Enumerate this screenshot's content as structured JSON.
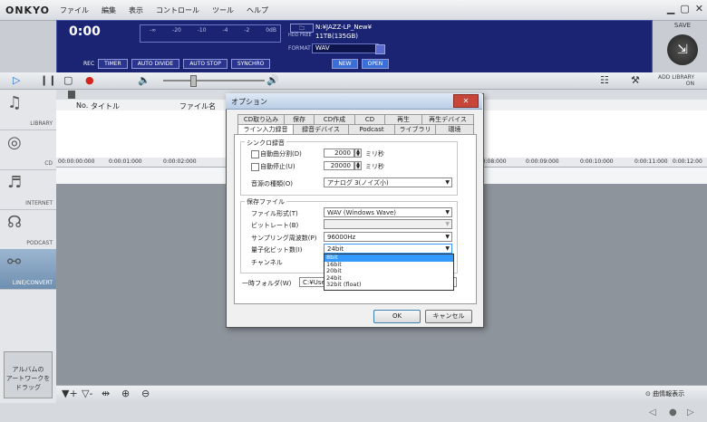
{
  "app": {
    "logo": "ONKYO",
    "menu": [
      "ファイル",
      "編集",
      "表示",
      "コントロール",
      "ツール",
      "ヘルプ"
    ]
  },
  "panel": {
    "time": "0:00",
    "meter_scale": [
      "-∞",
      "-20",
      "-10",
      "-4",
      "-2",
      "0dB"
    ],
    "directory": "N:¥JAZZ-LP_New¥",
    "hdd_free": "11TB(135GB)",
    "format_label": "FORMAT",
    "format_value": "WAV",
    "rec_label": "REC",
    "rec_buttons": [
      "TIMER",
      "AUTO DIVIDE",
      "AUTO STOP",
      "SYNCHRO"
    ],
    "new_label": "NEW",
    "open_label": "OPEN",
    "save_label": "SAVE"
  },
  "toolbar": {
    "add_library": "ADD LIBRARY",
    "add_library_state": "ON"
  },
  "sidebar": {
    "items": [
      {
        "label": "LIBRARY",
        "icon": "library-icon"
      },
      {
        "label": "CD",
        "icon": "cd-icon"
      },
      {
        "label": "INTERNET",
        "icon": "internet-icon"
      },
      {
        "label": "PODCAST",
        "icon": "podcast-icon"
      },
      {
        "label": "LINE/CONVERT",
        "icon": "line-convert-icon"
      }
    ],
    "album_art": "アルバムの\nアートワークを\nドラッグ"
  },
  "list": {
    "columns": [
      "No.",
      "タイトル",
      "ファイル名"
    ]
  },
  "timeline": [
    "00:00:00:000",
    "0:00:01:000",
    "0:00:02:000",
    "0:00:08:000",
    "0:00:09:000",
    "0:00:10:000",
    "0:00:11:000",
    "0:00:12:00"
  ],
  "bottom": {
    "song_info": "曲情報表示"
  },
  "dialog": {
    "title": "オプション",
    "tabs_row1": [
      "CD取り込み",
      "保存",
      "CD作成",
      "CD",
      "再生",
      "再生デバイス"
    ],
    "tabs_row2": [
      "ライン入力録音",
      "録音デバイス",
      "Podcast",
      "ライブラリ",
      "環境"
    ],
    "sync": {
      "group": "シンクロ録音",
      "auto_split_label": "自動曲分割(D)",
      "auto_split_value": "2000",
      "auto_stop_label": "自動停止(U)",
      "auto_stop_value": "20000",
      "unit": "ミリ秒",
      "source_label": "音源の種類(O)",
      "source_value": "アナログ 3(ノイズ小)"
    },
    "save": {
      "group": "保存ファイル",
      "format_label": "ファイル形式(T)",
      "format_value": "WAV (Windows Wave)",
      "bitrate_label": "ビットレート(B)",
      "bitrate_value": "",
      "sampling_label": "サンプリング周波数(P)",
      "sampling_value": "96000Hz",
      "bits_label": "量子化ビット数(I)",
      "bits_value": "24bit",
      "channel_label": "チャンネル",
      "bits_options": [
        "8bit",
        "16bit",
        "20bit",
        "24bit",
        "32bit (float)"
      ],
      "bits_highlighted": "8bit"
    },
    "temp_folder_label": "一時フォルダ(W)",
    "temp_folder_value": "C:¥User",
    "ok": "OK",
    "cancel": "キャンセル"
  }
}
